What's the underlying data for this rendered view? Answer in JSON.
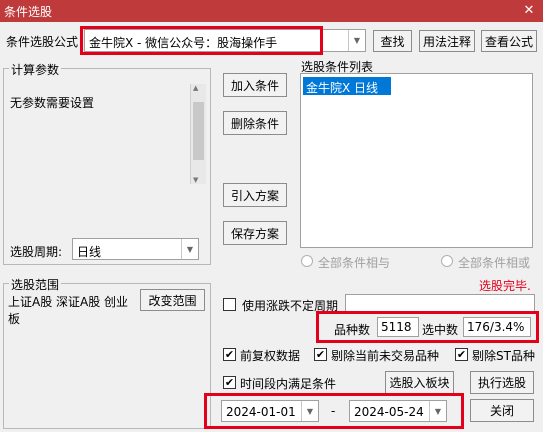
{
  "window": {
    "title": "条件选股",
    "close_glyph": "✕"
  },
  "formula": {
    "label": "条件选股公式",
    "value": "金牛院X  -  微信公众号：股海操作手"
  },
  "top_buttons": {
    "find": "查找",
    "usage": "用法注释",
    "view": "查看公式"
  },
  "params": {
    "legend": "计算参数",
    "text": "无参数需要设置"
  },
  "period": {
    "label": "选股周期:",
    "value": "日线"
  },
  "mid_buttons": {
    "add": "加入条件",
    "delete": "删除条件",
    "import": "引入方案",
    "save": "保存方案"
  },
  "conditions": {
    "legend": "选股条件列表",
    "items": [
      "金牛院X  日线"
    ]
  },
  "logic": {
    "all_and": "全部条件相与",
    "all_or": "全部条件相或"
  },
  "status": {
    "text": "选股完毕.",
    "color": "#e3001b"
  },
  "range": {
    "legend": "选股范围",
    "text": "上证A股 深证A股 创业板",
    "change_button": "改变范围"
  },
  "options": {
    "use_variable_period": "使用涨跌不定周期",
    "pre_adjust": "前复权数据",
    "exclude_untraded": "剔除当前未交易品种",
    "exclude_st": "剔除ST品种",
    "time_range": "时间段内满足条件"
  },
  "stats": {
    "count_label": "品种数",
    "count_value": "5118",
    "selected_label": "选中数",
    "selected_value": "176/3.4%"
  },
  "dates": {
    "start": "2024-01-01",
    "separator": "-",
    "end": "2024-05-24"
  },
  "bottom_buttons": {
    "to_block": "选股入板块",
    "execute": "执行选股",
    "close": "关闭"
  },
  "colors": {
    "title_bar": "#bf3b3b",
    "highlight": "#e3001b",
    "selection": "#0078d7"
  }
}
